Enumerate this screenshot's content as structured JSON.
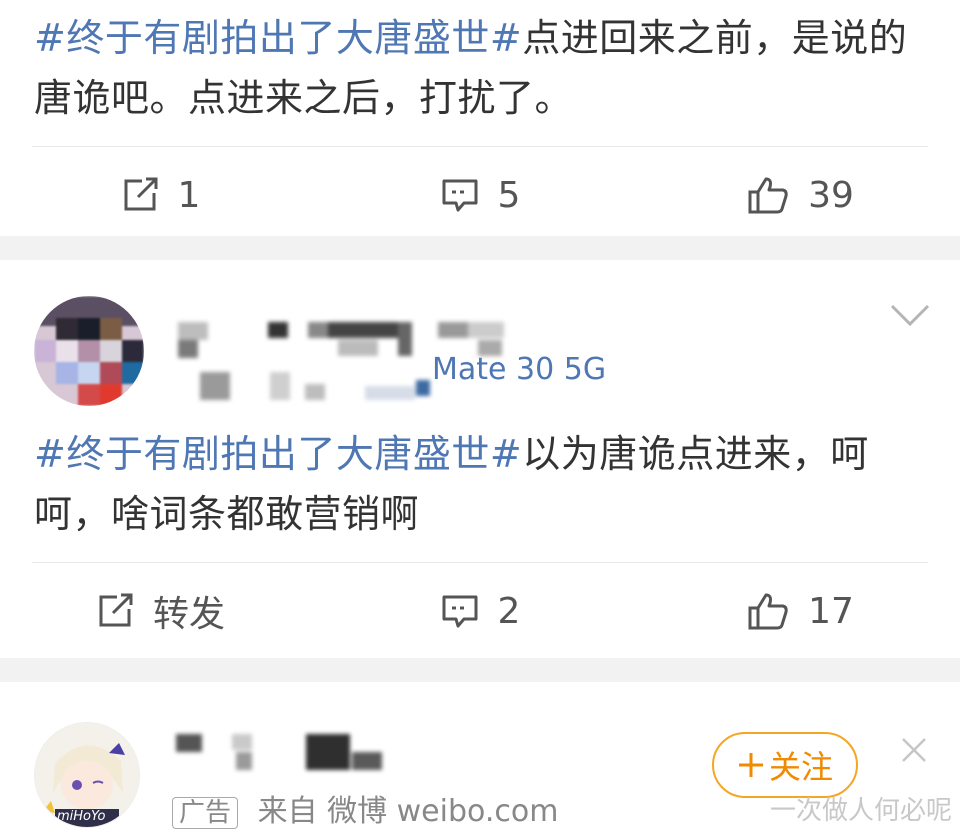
{
  "post1": {
    "hashtag": "#终于有剧拍出了大唐盛世#",
    "text_line1_rest": "点进回来之前，是说的",
    "text_line2": "唐诡吧。点进来之后，打扰了。",
    "repost_count": "1",
    "comment_count": "5",
    "like_count": "39"
  },
  "post2": {
    "source": "Mate 30 5G",
    "hashtag": "#终于有剧拍出了大唐盛世#",
    "text_line1_rest": "以为唐诡点进来，呵",
    "text_line2": "呵，啥词条都敢营销啊",
    "repost_label": "转发",
    "comment_count": "2",
    "like_count": "17"
  },
  "ad_post": {
    "follow_label": "关注",
    "ad_badge": "广告",
    "source_text": "来自 微博 weibo.com",
    "avatar_text": "miHoYo"
  },
  "watermark": "一次做人何必呢",
  "colors": {
    "hashtag": "#4f77b3",
    "follow": "#f08a00"
  },
  "icons": [
    "repost-icon",
    "comment-icon",
    "like-icon",
    "chevron-down-icon",
    "close-icon",
    "plus-icon"
  ]
}
